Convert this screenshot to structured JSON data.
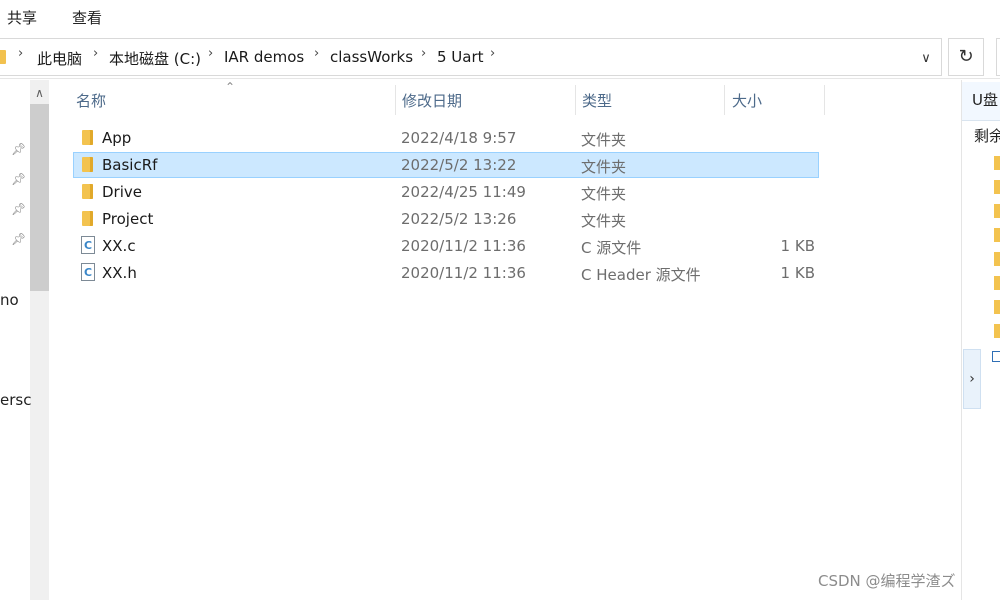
{
  "ribbon": {
    "menus": [
      "共享",
      "查看"
    ]
  },
  "address": {
    "crumbs": [
      "此电脑",
      "本地磁盘 (C:)",
      "IAR demos",
      "classWorks",
      "5 Uart"
    ]
  },
  "nav": {
    "partial_labels": [
      "no",
      "ersc"
    ]
  },
  "columns": {
    "name": "名称",
    "date": "修改日期",
    "type": "类型",
    "size": "大小"
  },
  "files": [
    {
      "name": "App",
      "date": "2022/4/18 9:57",
      "type": "文件夹",
      "size": "",
      "icon": "folder-icon"
    },
    {
      "name": "BasicRf",
      "date": "2022/5/2 13:22",
      "type": "文件夹",
      "size": "",
      "icon": "folder-icon",
      "selected": true
    },
    {
      "name": "Drive",
      "date": "2022/4/25 11:49",
      "type": "文件夹",
      "size": "",
      "icon": "folder-icon"
    },
    {
      "name": "Project",
      "date": "2022/5/2 13:26",
      "type": "文件夹",
      "size": "",
      "icon": "folder-icon"
    },
    {
      "name": "XX.c",
      "date": "2020/11/2 11:36",
      "type": "C 源文件",
      "size": "1 KB",
      "icon": "c-source-file-icon"
    },
    {
      "name": "XX.h",
      "date": "2020/11/2 11:36",
      "type": "C Header 源文件",
      "size": "1 KB",
      "icon": "c-header-file-icon"
    }
  ],
  "preview": {
    "title": "U盘",
    "remaining": "剩余"
  },
  "watermark": "CSDN @编程学渣ズ",
  "colors": {
    "selection_bg": "#cce8ff",
    "selection_border": "#99d1ff",
    "header_text": "#4d6a8a",
    "folder": "#f3c34f"
  }
}
